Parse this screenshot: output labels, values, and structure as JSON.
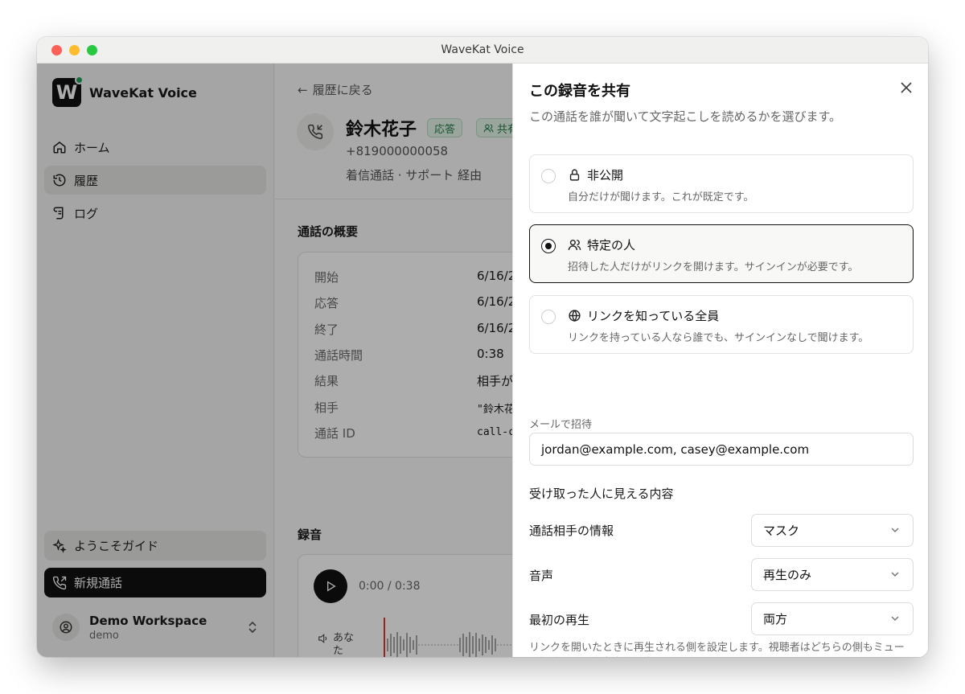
{
  "window": {
    "title": "WaveKat Voice"
  },
  "sidebar": {
    "brand": "WaveKat Voice",
    "logo_letter": "W",
    "items": [
      {
        "label": "ホーム",
        "icon": "home-icon"
      },
      {
        "label": "履歴",
        "icon": "history-icon"
      },
      {
        "label": "ログ",
        "icon": "log-icon"
      }
    ],
    "guide_label": "ようこそガイド",
    "new_call_label": "新規通話",
    "workspace": {
      "name": "Demo Workspace",
      "sub": "demo"
    }
  },
  "main": {
    "back_label": "履歴に戻る",
    "contact_name": "鈴木花子",
    "badge_answer": "応答",
    "badge_share": "共有",
    "phone": "+819000000058",
    "meta": "着信通話 · サポート 経由",
    "summary_title": "通話の概要",
    "summary": [
      {
        "label": "開始",
        "value": "6/16/2"
      },
      {
        "label": "応答",
        "value": "6/16/2"
      },
      {
        "label": "終了",
        "value": "6/16/2"
      },
      {
        "label": "通話時間",
        "value": "0:38"
      },
      {
        "label": "結果",
        "value": "相手が"
      },
      {
        "label": "相手",
        "value": "\"鈴木花"
      },
      {
        "label": "通話 ID",
        "value": "call-c"
      }
    ],
    "recording_title": "録音",
    "time": "0:00 / 0:38",
    "track_label": "あなた"
  },
  "drawer": {
    "title": "この録音を共有",
    "subtitle": "この通話を誰が聞いて文字起こしを読めるかを選びます。",
    "options": [
      {
        "title": "非公開",
        "desc": "自分だけが聞けます。これが既定です。",
        "icon": "lock-icon"
      },
      {
        "title": "特定の人",
        "desc": "招待した人だけがリンクを開けます。サインインが必要です。",
        "icon": "users-icon"
      },
      {
        "title": "リンクを知っている全員",
        "desc": "リンクを持っている人なら誰でも、サインインなしで聞けます。",
        "icon": "globe-icon"
      }
    ],
    "selected_index": 1,
    "email_label": "メールで招待",
    "email_value": "jordan@example.com, casey@example.com",
    "visible_heading": "受け取った人に見える内容",
    "rows": [
      {
        "label": "通話相手の情報",
        "value": "マスク"
      },
      {
        "label": "音声",
        "value": "再生のみ"
      },
      {
        "label": "最初の再生",
        "value": "両方"
      }
    ],
    "hint": "リンクを開いたときに再生される側を設定します。視聴者はどちらの側もミュート解除でき、録音自体は変更されません。"
  }
}
